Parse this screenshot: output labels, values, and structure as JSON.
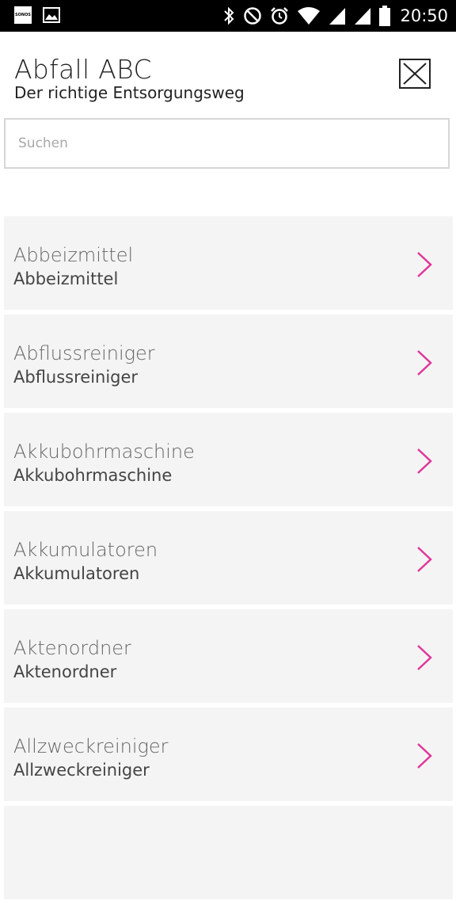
{
  "statusbar": {
    "time": "20:50",
    "sonos_label": "SONOS"
  },
  "header": {
    "title": "Abfall ABC",
    "subtitle": "Der richtige Entsorgungsweg"
  },
  "search": {
    "placeholder": "Suchen"
  },
  "colors": {
    "accent": "#e0379b",
    "item_bg": "#f4f4f4"
  },
  "items": [
    {
      "title": "Abbeizmittel",
      "subtitle": "Abbeizmittel"
    },
    {
      "title": "Abflussreiniger",
      "subtitle": "Abflussreiniger"
    },
    {
      "title": "Akkubohrmaschine",
      "subtitle": "Akkubohrmaschine"
    },
    {
      "title": "Akkumulatoren",
      "subtitle": "Akkumulatoren"
    },
    {
      "title": "Aktenordner",
      "subtitle": "Aktenordner"
    },
    {
      "title": "Allzweckreiniger",
      "subtitle": "Allzweckreiniger"
    }
  ]
}
